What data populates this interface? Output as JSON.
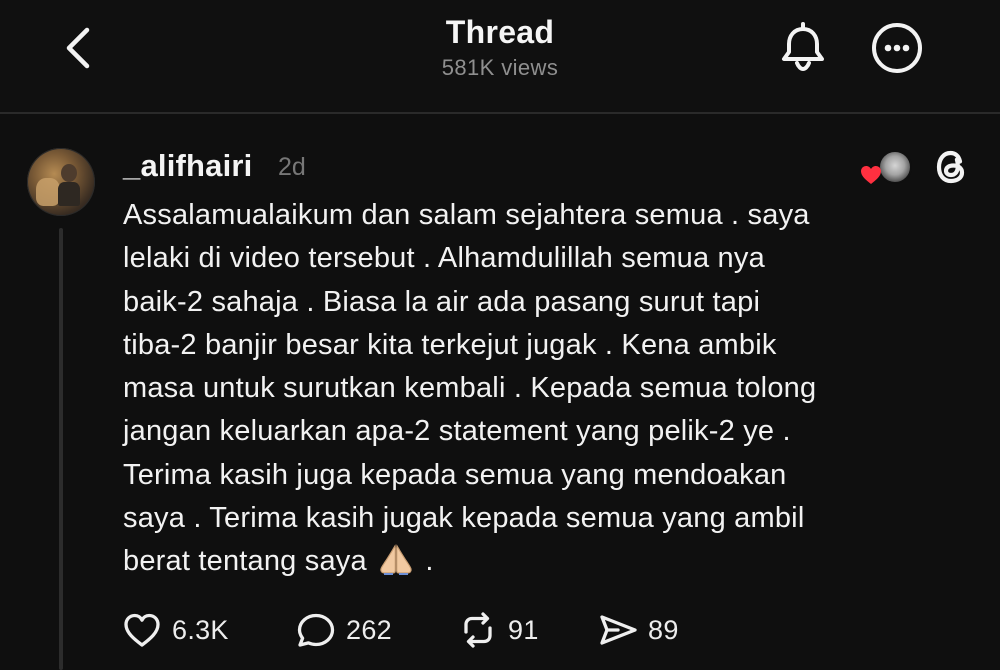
{
  "header": {
    "title": "Thread",
    "views": "581K views"
  },
  "post": {
    "username": "_alifhairi",
    "timestamp": "2d",
    "text_lines": [
      "Assalamualaikum dan salam sejahtera semua . saya",
      "lelaki di video tersebut . Alhamdulillah semua nya",
      "baik-2 sahaja . Biasa la air ada pasang surut tapi",
      "tiba-2 banjir besar kita terkejut jugak . Kena ambik",
      "masa untuk surutkan kembali . Kepada semua tolong",
      "jangan keluarkan apa-2 statement yang pelik-2 ye .",
      "Terima kasih juga kepada semua yang mendoakan",
      "saya . Terima kasih jugak kepada semua yang ambil",
      "berat tentang saya"
    ],
    "text_end": " ."
  },
  "actions": {
    "likes": "6.3K",
    "replies": "262",
    "reposts": "91",
    "shares": "89"
  },
  "icons": {
    "back": "chevron-left-icon",
    "notifications": "bell-icon",
    "more": "more-icon",
    "threads_logo": "threads-logo",
    "liked_badge": "heart-icon",
    "emoji": "folded-hands-emoji"
  },
  "colors": {
    "background": "#0f0f0f",
    "text": "#f2f2f2",
    "muted": "#8f8f8f",
    "heart": "#ff3040"
  }
}
